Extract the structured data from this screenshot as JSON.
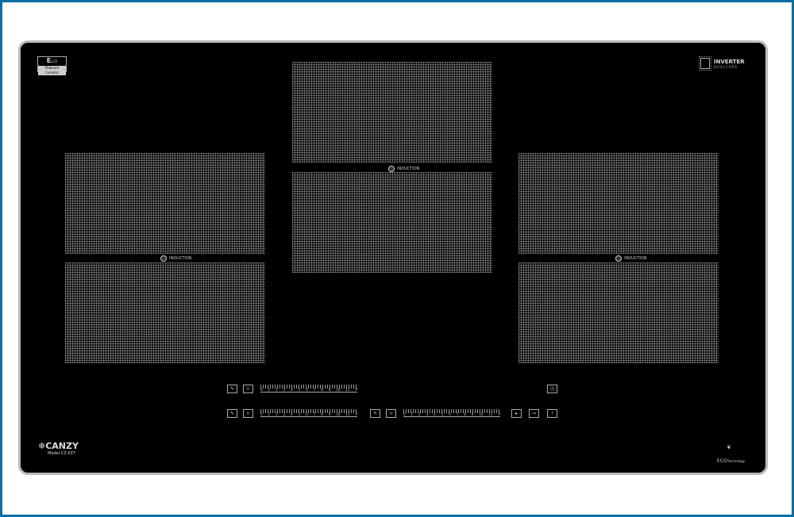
{
  "badge": {
    "letter": "E",
    "sub_mark": "LCD",
    "label": "Platinum Ceramic"
  },
  "inverter": {
    "line1": "INVERTER",
    "line2": "DUALCORE"
  },
  "brand": {
    "name": "CANZY",
    "model": "Model:CZ-03T"
  },
  "eco": {
    "word": "ECO",
    "suffix": "Technology"
  },
  "zones": {
    "induction_label": "INDUCTION"
  },
  "slider_labels": [
    "0",
    "1",
    "2",
    "3",
    "4",
    "5",
    "6",
    "7",
    "8",
    "9",
    "10",
    "11",
    "P"
  ],
  "icons": [
    "pot-icon",
    "heat-icon",
    "timer-icon",
    "play-pause-icon",
    "lock-icon",
    "power-icon"
  ],
  "colors": {
    "frame": "#0b6ea3",
    "hob": "#000000",
    "rim": "#b9b9b9"
  }
}
